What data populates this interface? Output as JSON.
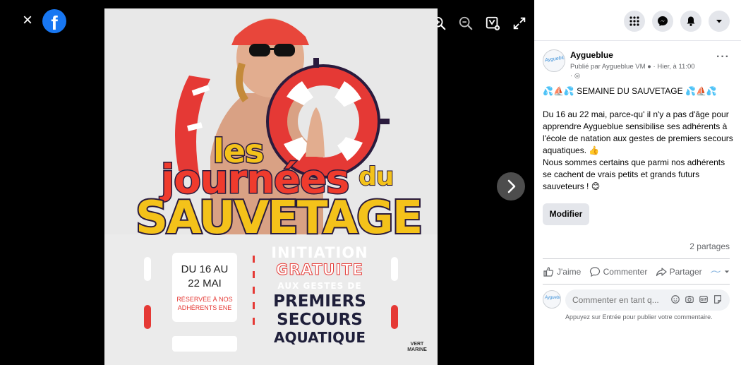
{
  "viewer": {
    "close_label": "×",
    "logo_letter": "f"
  },
  "poster": {
    "headline_les": "les",
    "headline_journees": "journées",
    "headline_du": "du",
    "headline_sauvetage": "SAUVETAGE",
    "date_line1": "DU 16 AU",
    "date_line2": "22 MAI",
    "reserved_line1": "RÉSERVÉE À NOS",
    "reserved_line2": "ADHÉRENTS ENE",
    "initiation": "INITIATION",
    "gratuite": "GRATUITE",
    "aux_gestes": "AUX GESTES DE",
    "premiers": "PREMIERS",
    "secours": "SECOURS",
    "aquatique": "AQUATIQUE",
    "brand_line1": "VERT",
    "brand_line2": "MARINE"
  },
  "post": {
    "page_name": "Aygueblue",
    "avatar_text": "Aygueblue",
    "meta_line1": "Publié par Aygueblue VM",
    "meta_time": "· Hier, à 11:00",
    "meta_line2": "·",
    "more_label": "···",
    "title_text": "SEMAINE DU SAUVETAGE",
    "emoji_left": "💦⛵💦",
    "emoji_right": "💦⛵💦",
    "paragraph1": "Du 16 au 22 mai, parce-qu' il n'y a pas d'âge pour apprendre Aygueblue sensibilise ses adhérents à l'école de natation aux gestes de premiers secours aquatiques.",
    "emoji_thumb": "👍",
    "paragraph2": "Nous sommes certains que parmi nos adhérents se cachent de vrais petits et grands futurs sauveteurs !",
    "emoji_smile": "😊",
    "modify_label": "Modifier",
    "shares": "2 partages"
  },
  "actions": {
    "like": "J'aime",
    "comment": "Commenter",
    "share": "Partager"
  },
  "comment": {
    "placeholder": "Commenter en tant q...",
    "hint": "Appuyez sur Entrée pour publier votre commentaire."
  },
  "colors": {
    "facebook_blue": "#1877f2",
    "poster_red": "#e53935",
    "poster_yellow": "#f4c21a",
    "poster_navy": "#1f1f3a"
  },
  "icons": {
    "top": [
      "apps-grid-icon",
      "messenger-icon",
      "notifications-bell-icon",
      "account-chevron-icon"
    ],
    "viewer": [
      "zoom-in-icon",
      "zoom-out-icon",
      "tag-icon",
      "fullscreen-icon"
    ]
  }
}
